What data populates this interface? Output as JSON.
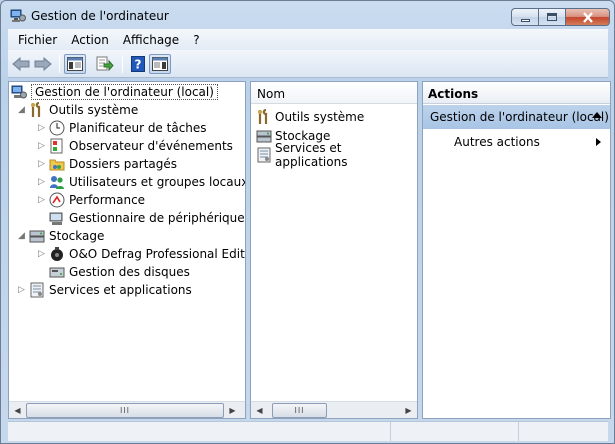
{
  "window": {
    "title": "Gestion de l'ordinateur"
  },
  "menu": [
    "Fichier",
    "Action",
    "Affichage",
    "?"
  ],
  "toolbar": {
    "icons": [
      "back-arrow-icon",
      "forward-arrow-icon",
      "show-hide-tree-icon",
      "export-list-icon",
      "help-icon",
      "show-hide-action-pane-icon"
    ]
  },
  "tree": {
    "root": "Gestion de l'ordinateur (local)",
    "items": [
      {
        "label": "Outils système",
        "level": 1,
        "expander": "expanded",
        "icon": "tools-icon"
      },
      {
        "label": "Planificateur de tâches",
        "level": 2,
        "expander": "collapsed",
        "icon": "clock-icon"
      },
      {
        "label": "Observateur d'événements",
        "level": 2,
        "expander": "collapsed",
        "icon": "event-viewer-icon"
      },
      {
        "label": "Dossiers partagés",
        "level": 2,
        "expander": "collapsed",
        "icon": "shared-folder-icon"
      },
      {
        "label": "Utilisateurs et groupes locaux",
        "level": 2,
        "expander": "collapsed",
        "icon": "users-icon"
      },
      {
        "label": "Performance",
        "level": 2,
        "expander": "collapsed",
        "icon": "performance-icon"
      },
      {
        "label": "Gestionnaire de périphériques",
        "level": 2,
        "expander": "none",
        "icon": "device-manager-icon"
      },
      {
        "label": "Stockage",
        "level": 1,
        "expander": "expanded",
        "icon": "storage-icon"
      },
      {
        "label": "O&O Defrag Professional Edition",
        "level": 2,
        "expander": "collapsed",
        "icon": "defrag-icon"
      },
      {
        "label": "Gestion des disques",
        "level": 2,
        "expander": "none",
        "icon": "disk-management-icon"
      },
      {
        "label": "Services et applications",
        "level": 1,
        "expander": "collapsed",
        "icon": "services-icon"
      }
    ]
  },
  "list": {
    "column_header": "Nom",
    "items": [
      {
        "label": "Outils système",
        "icon": "tools-icon"
      },
      {
        "label": "Stockage",
        "icon": "storage-icon"
      },
      {
        "label": "Services et applications",
        "icon": "services-icon"
      }
    ]
  },
  "actions": {
    "header": "Actions",
    "section": "Gestion de l'ordinateur (local)",
    "items": [
      "Autres actions"
    ]
  },
  "scrollbar": {
    "thumb_grip": "III"
  },
  "colors": {
    "selection": "#b3cdea",
    "frame": "#b9d1ea"
  }
}
